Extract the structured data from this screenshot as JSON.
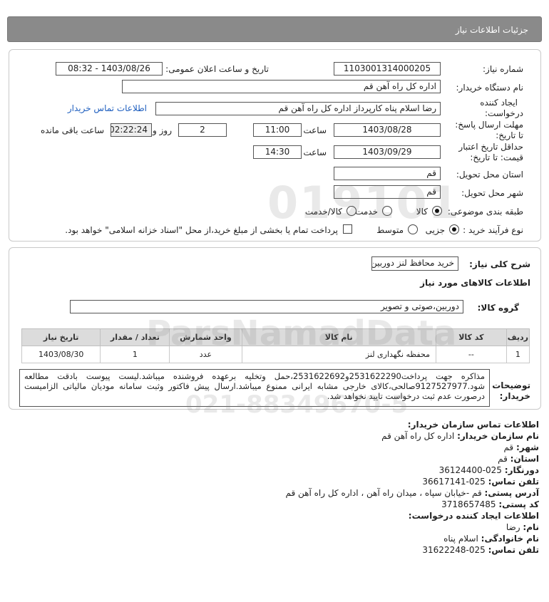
{
  "header": {
    "title": "جزئیات اطلاعات نیاز"
  },
  "need": {
    "need_number_label": "شماره نیاز:",
    "need_number": "1103001314000205",
    "announce_label": "تاریخ و ساعت اعلان عمومی:",
    "announce_value": "1403/08/26 - 08:32",
    "buyer_org_label": "نام دستگاه خریدار:",
    "buyer_org": "اداره کل  راه آهن قم",
    "creator_label_1": "ایجاد کننده",
    "creator_label_2": "درخواست:",
    "creator": "رضا اسلام پناه کارپرداز اداره کل  راه آهن قم",
    "contact_link": "اطلاعات تماس خریدار",
    "deadline_label_1": "مهلت ارسال پاسخ:",
    "deadline_label_2": "تا تاریخ:",
    "deadline_date": "1403/08/28",
    "time_label": "ساعت",
    "deadline_time": "11:00",
    "days_value": "2",
    "days_label": "روز و",
    "remaining_time": "02:22:24",
    "remaining_label": "ساعت باقی مانده",
    "validity_label_1": "حداقل تاریخ اعتبار",
    "validity_label_2": "قیمت: تا تاریخ:",
    "validity_date": "1403/09/29",
    "validity_time_label": "ساعت",
    "validity_time": "14:30",
    "province_label": "استان محل تحویل:",
    "province": "قم",
    "city_label": "شهر محل تحویل:",
    "city": "قم",
    "category_label": "طبقه بندی موضوعی:",
    "category_options": [
      "کالا",
      "خدمت",
      "کالا/خدمت"
    ],
    "process_label": "نوع فرآیند خرید :",
    "process_options": [
      "جزیی",
      "متوسط"
    ],
    "payment_note": "پرداخت تمام یا بخشی از مبلغ خرید،از محل \"اسناد خزانه اسلامی\" خواهد بود."
  },
  "goods": {
    "summary_label": "شرح کلی نیاز:",
    "summary": "خرید محافظ لنز دوربین",
    "section_title": "اطلاعات کالاهای مورد نیاز",
    "group_label": "گروه کالا:",
    "group": "دوربین،صوتی و تصویر",
    "columns": [
      "ردیف",
      "کد کالا",
      "نام کالا",
      "واحد شمارش",
      "تعداد / مقدار",
      "تاریخ نیاز"
    ],
    "rows": [
      {
        "row": "1",
        "code": "--",
        "name": "محفظه نگهداری لنز",
        "unit": "عدد",
        "qty": "1",
        "date": "1403/08/30"
      }
    ],
    "buyer_notes_label_1": "توضیحات",
    "buyer_notes_label_2": "خریدار:",
    "buyer_notes": "مذاکره جهت پرداخت2531622290و2531622692،حمل وتخلیه برعهده فروشنده میباشد.لیست پیوست بادقت مطالعه شود.9127527977صالحی،کالای خارجی مشابه ایرانی ممنوع میباشد.ارسال پیش فاکتور وثبت سامانه مودیان مالیاتی الزامیست درصورت عدم ثبت درخواست تایید نخواهد شد."
  },
  "contact": {
    "org_title": "اطلاعات تماس سازمان خریدار:",
    "buyer_name_label": "نام سازمان خریدار:",
    "buyer_name": "اداره کل راه آهن قم",
    "city_label": "شهر:",
    "city": "قم",
    "province_label": "استان:",
    "province": "قم",
    "fax_label": "دورنگار:",
    "fax": "025-36124400",
    "phone_label": "تلفن تماس:",
    "phone": "025-36617141",
    "address_label": "آدرس پستی:",
    "address": "قم -خیابان سپاه ، میدان راه آهن ، اداره کل راه آهن قم",
    "postal_label": "کد پستی:",
    "postal": "3718657485",
    "creator_title": "اطلاعات ایجاد کننده درخواست:",
    "first_name_label": "نام:",
    "first_name": "رضا",
    "last_name_label": "نام خانوادگی:",
    "last_name": "اسلام پناه",
    "creator_phone_label": "تلفن تماس:",
    "creator_phone": "025-31622248"
  }
}
